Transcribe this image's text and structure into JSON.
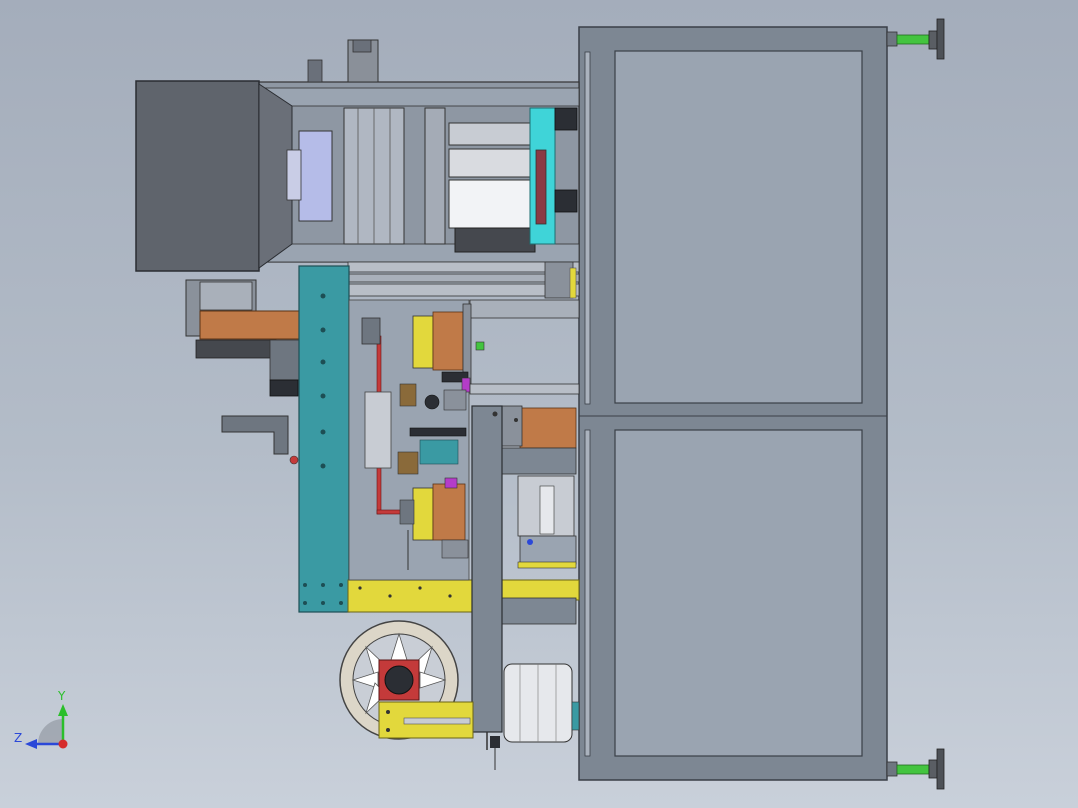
{
  "viewport": {
    "background_top": "#a4adbb",
    "background_bottom": "#c9d0da"
  },
  "palette": {
    "frame_gray": "#7d8793",
    "panel_fill": "#9aa4b1",
    "dark_gray": "#5f646c",
    "teal": "#3a9aa3",
    "yellow": "#e2d83c",
    "copper": "#c07a48",
    "cyan": "#3fd4d8",
    "green_feet": "#43c43f",
    "red": "#c43a3a",
    "wheel_fill": "#dcd6c8"
  },
  "triad": {
    "y_label": "Y",
    "z_label": "Z",
    "y_color": "#2bbf2b",
    "z_color": "#2b48d8",
    "x_color": "#d62b2b"
  }
}
